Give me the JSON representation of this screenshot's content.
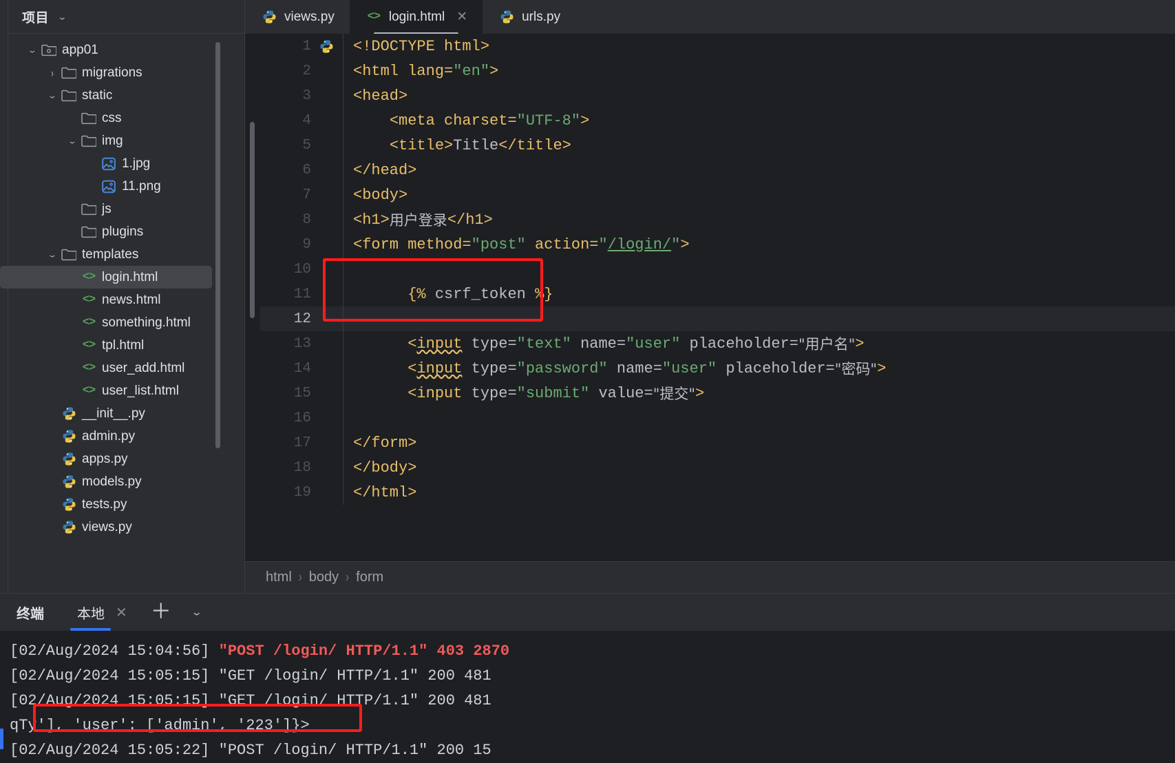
{
  "sidebar": {
    "title": "项目",
    "chevron_icon": "chevron-down-icon",
    "tree": [
      {
        "label": "app01",
        "indent": 1,
        "arrow": "down",
        "icon": "module-folder-icon"
      },
      {
        "label": "migrations",
        "indent": 2,
        "arrow": "right",
        "icon": "folder-icon"
      },
      {
        "label": "static",
        "indent": 2,
        "arrow": "down",
        "icon": "folder-icon"
      },
      {
        "label": "css",
        "indent": 3,
        "arrow": "none",
        "icon": "folder-icon"
      },
      {
        "label": "img",
        "indent": 3,
        "arrow": "down",
        "icon": "folder-icon"
      },
      {
        "label": "1.jpg",
        "indent": 4,
        "arrow": "none",
        "icon": "image-file-icon"
      },
      {
        "label": "11.png",
        "indent": 4,
        "arrow": "none",
        "icon": "image-file-icon"
      },
      {
        "label": "js",
        "indent": 3,
        "arrow": "none",
        "icon": "folder-icon"
      },
      {
        "label": "plugins",
        "indent": 3,
        "arrow": "none",
        "icon": "folder-icon"
      },
      {
        "label": "templates",
        "indent": 2,
        "arrow": "down",
        "icon": "folder-icon"
      },
      {
        "label": "login.html",
        "indent": 3,
        "arrow": "none",
        "icon": "html-file-icon",
        "selected": true
      },
      {
        "label": "news.html",
        "indent": 3,
        "arrow": "none",
        "icon": "html-file-icon"
      },
      {
        "label": "something.html",
        "indent": 3,
        "arrow": "none",
        "icon": "html-file-icon"
      },
      {
        "label": "tpl.html",
        "indent": 3,
        "arrow": "none",
        "icon": "html-file-icon"
      },
      {
        "label": "user_add.html",
        "indent": 3,
        "arrow": "none",
        "icon": "html-file-icon"
      },
      {
        "label": "user_list.html",
        "indent": 3,
        "arrow": "none",
        "icon": "html-file-icon"
      },
      {
        "label": "__init__.py",
        "indent": 2,
        "arrow": "none",
        "icon": "python-file-icon"
      },
      {
        "label": "admin.py",
        "indent": 2,
        "arrow": "none",
        "icon": "python-file-icon"
      },
      {
        "label": "apps.py",
        "indent": 2,
        "arrow": "none",
        "icon": "python-file-icon"
      },
      {
        "label": "models.py",
        "indent": 2,
        "arrow": "none",
        "icon": "python-file-icon"
      },
      {
        "label": "tests.py",
        "indent": 2,
        "arrow": "none",
        "icon": "python-file-icon"
      },
      {
        "label": "views.py",
        "indent": 2,
        "arrow": "none",
        "icon": "python-file-icon"
      }
    ]
  },
  "editor": {
    "tabs": [
      {
        "label": "views.py",
        "icon": "python-file-icon",
        "active": false,
        "closable": false
      },
      {
        "label": "login.html",
        "icon": "html-file-icon",
        "active": true,
        "closable": true
      },
      {
        "label": "urls.py",
        "icon": "python-file-icon",
        "active": false,
        "closable": false
      }
    ],
    "close_icon": "close-icon",
    "current_line": 12,
    "lines": [
      {
        "n": 1,
        "gutter_icon": "python-file-icon"
      },
      {
        "n": 2
      },
      {
        "n": 3
      },
      {
        "n": 4
      },
      {
        "n": 5
      },
      {
        "n": 6
      },
      {
        "n": 7
      },
      {
        "n": 8
      },
      {
        "n": 9
      },
      {
        "n": 10
      },
      {
        "n": 11
      },
      {
        "n": 12
      },
      {
        "n": 13
      },
      {
        "n": 14
      },
      {
        "n": 15
      },
      {
        "n": 16
      },
      {
        "n": 17
      },
      {
        "n": 18
      },
      {
        "n": 19
      }
    ],
    "code": {
      "l1_doctype": "<!DOCTYPE html>",
      "l2_tag": "<html lang=",
      "l2_str": "\"en\"",
      "l2_close": ">",
      "l3": "<head>",
      "l4_indent": "    ",
      "l4_tag": "<meta charset=",
      "l4_str": "\"UTF-8\"",
      "l4_close": ">",
      "l5_indent": "    ",
      "l5_open": "<title>",
      "l5_text": "Title",
      "l5_close": "</title>",
      "l6": "</head>",
      "l7": "<body>",
      "l8_open": "<h1>",
      "l8_text": "用户登录",
      "l8_close": "</h1>",
      "l9_tag1": "<form method=",
      "l9_str1": "\"post\"",
      "l9_tag2": " action=",
      "l9_q1": "\"",
      "l9_link": "/login/",
      "l9_q2": "\"",
      "l9_close": ">",
      "l11_indent": "      ",
      "l11_open": "{%",
      "l11_name": " csrf_token ",
      "l11_end": "%}",
      "l13_indent": "      ",
      "l13_tag": "<",
      "l13_el": "input",
      "l13_a1": " type=",
      "l13_s1": "\"text\"",
      "l13_a2": " name=",
      "l13_s2": "\"user\"",
      "l13_a3": " placeholder=",
      "l13_s3": "\"用户名\"",
      "l13_close": ">",
      "l14_indent": "      ",
      "l14_tag": "<",
      "l14_el": "input",
      "l14_a1": " type=",
      "l14_s1": "\"password\"",
      "l14_a2": " name=",
      "l14_s2": "\"user\"",
      "l14_a3": " placeholder=",
      "l14_s3": "\"密码\"",
      "l14_close": ">",
      "l15_indent": "      ",
      "l15_tag": "<input",
      "l15_a1": " type=",
      "l15_s1": "\"submit\"",
      "l15_a2": " value=",
      "l15_s2": "\"提交\"",
      "l15_close": ">",
      "l17": "</form>",
      "l18": "</body>",
      "l19": "</html>"
    },
    "breadcrumb": [
      "html",
      "body",
      "form"
    ],
    "breadcrumb_separator": "›"
  },
  "terminal": {
    "title": "终端",
    "tab_label": "本地",
    "close_icon": "close-icon",
    "add_icon": "plus-icon",
    "options_icon": "chevron-down-icon",
    "lines": [
      {
        "prefix": "[02/Aug/2024 15:04:56] ",
        "highlight": "\"POST /login/ HTTP/1.1\" 403 2870",
        "suffix": ""
      },
      {
        "prefix": "[02/Aug/2024 15:05:15] \"GET /login/ HTTP/1.1\" 200 481",
        "highlight": "",
        "suffix": ""
      },
      {
        "prefix": "[02/Aug/2024 15:05:15] \"GET /login/ HTTP/1.1\" 200 481",
        "highlight": "",
        "suffix": ""
      },
      {
        "prefix": "qTy'], 'user': ['admin', '223']}>",
        "highlight": "",
        "suffix": ""
      },
      {
        "prefix": "[02/Aug/2024 15:05:22] \"POST /login/ HTTP/1.1\" 200 15",
        "highlight": "",
        "suffix": ""
      }
    ]
  },
  "colors": {
    "annotation_red": "#ff1c1c",
    "accent_blue": "#3574f0",
    "tag": "#e8bf6a",
    "string": "#6aab73",
    "text": "#bcbec4"
  }
}
